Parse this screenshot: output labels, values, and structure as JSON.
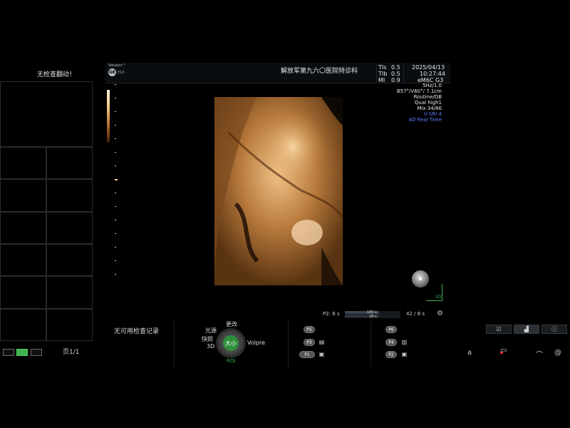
{
  "left_panel": {
    "status_message": "无检查翻动！",
    "page_indicator": "页1/1"
  },
  "header": {
    "logo_text": "Voluson™",
    "logo_small": "E10",
    "hospital": "解放军第九六〇医院特诊科",
    "tis_label": "TIs",
    "tis_value": "0.5",
    "tib_label": "TIb",
    "tib_value": "0.5",
    "mi_label": "MI",
    "mi_value": "0.9",
    "date": "2025/04/13",
    "time": "10:27:44",
    "probe": "eM6C G3"
  },
  "info": {
    "line1": "5Hz/1.0",
    "line2": "B57°/V60°/ 7.1cm",
    "line3": "Routine/OB",
    "line4": "Qual high1",
    "line5": "Mix 34/66",
    "line6": "V-SRI 4",
    "line7": "4D Real Time"
  },
  "orientation": {
    "label": "3D"
  },
  "cine": {
    "label": "P2:",
    "start": "8 s",
    "val_top": "180 s",
    "val_bottom": "28 s",
    "frames": "42 / 8 s"
  },
  "touch_panel": {
    "no_records": "无可用检查记录",
    "knob_top": "更改",
    "knob_left_top": "光源",
    "knob_left_mid": "快照",
    "knob_left_bottom": "3D",
    "knob_center": "大小",
    "knob_right": "Volpre",
    "knob_bottom": "ROI",
    "p_buttons_left": [
      "P5",
      "P3",
      "P1"
    ],
    "p_buttons_right": [
      "P6",
      "P4",
      "P2"
    ]
  },
  "bottom_right": {
    "text_a": "a"
  },
  "colors": {
    "accent_green": "#3fb34f",
    "info_blue": "#5e7bff",
    "render_tone": "#c88a48"
  }
}
